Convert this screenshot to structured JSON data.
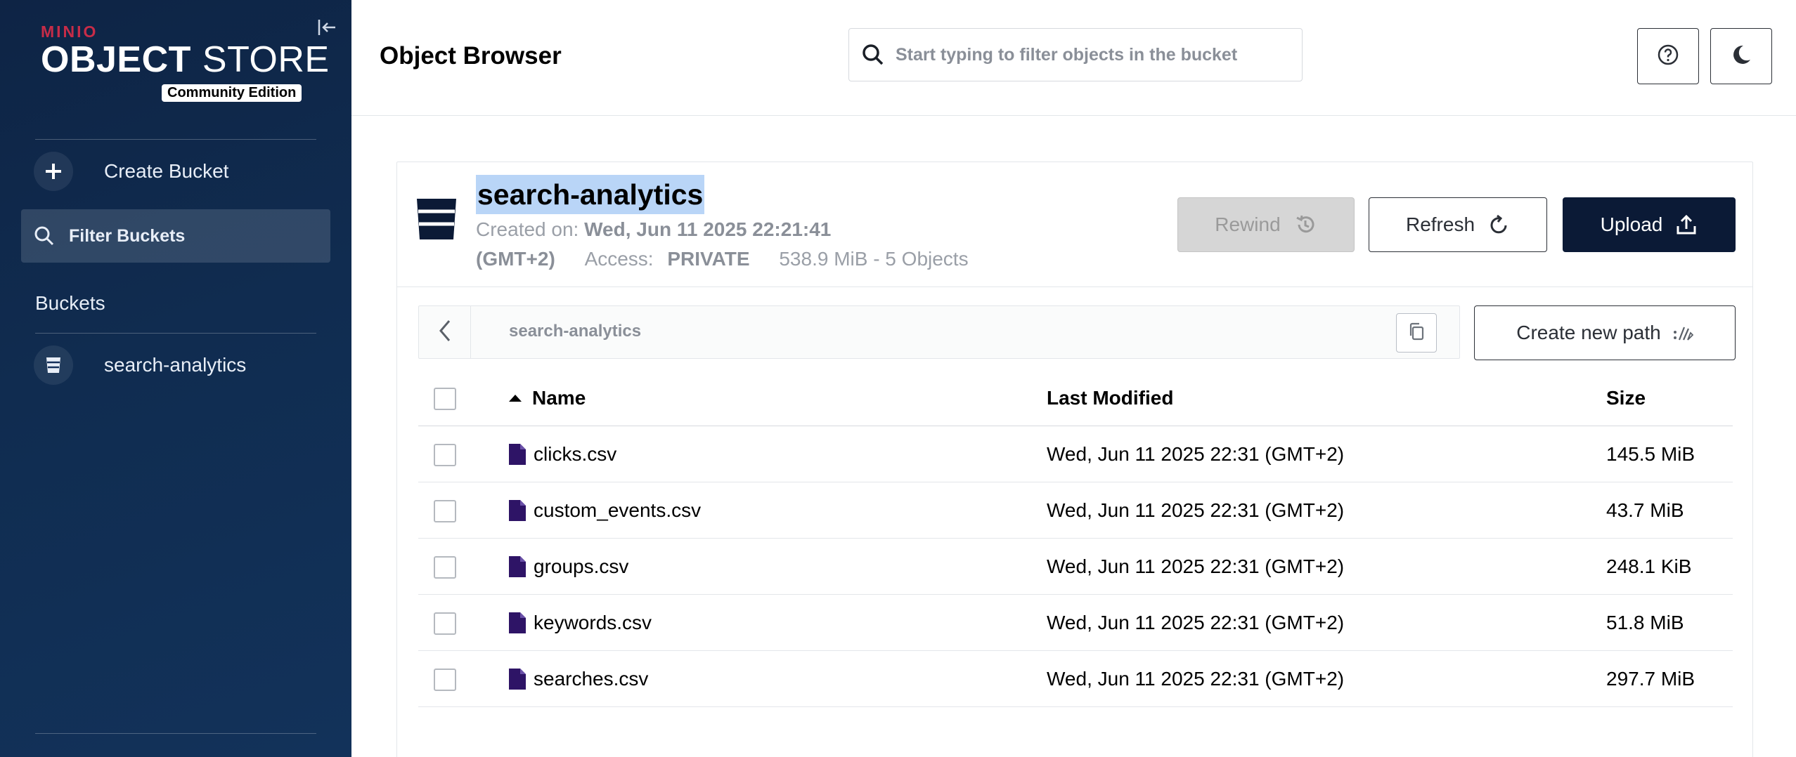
{
  "sidebar": {
    "logo": {
      "brand": "MINIO",
      "line1": "OBJECT",
      "line2": "STORE",
      "edition": "Community Edition"
    },
    "create_bucket": "Create Bucket",
    "filter_buckets": "Filter Buckets",
    "buckets_heading": "Buckets",
    "buckets": [
      {
        "name": "search-analytics"
      }
    ]
  },
  "header": {
    "title": "Object Browser",
    "search_placeholder": "Start typing to filter objects in the bucket"
  },
  "bucket": {
    "name": "search-analytics",
    "created_label": "Created on:",
    "created_value": "Wed, Jun 11 2025 22:21:41",
    "created_tz": "(GMT+2)",
    "access_label": "Access:",
    "access_value": "PRIVATE",
    "usage": "538.9 MiB - 5 Objects"
  },
  "actions": {
    "rewind": "Rewind",
    "refresh": "Refresh",
    "upload": "Upload",
    "create_path": "Create new path"
  },
  "path": {
    "current": "search-analytics"
  },
  "table": {
    "columns": {
      "name": "Name",
      "modified": "Last Modified",
      "size": "Size"
    },
    "rows": [
      {
        "name": "clicks.csv",
        "modified": "Wed, Jun 11 2025 22:31 (GMT+2)",
        "size": "145.5 MiB"
      },
      {
        "name": "custom_events.csv",
        "modified": "Wed, Jun 11 2025 22:31 (GMT+2)",
        "size": "43.7 MiB"
      },
      {
        "name": "groups.csv",
        "modified": "Wed, Jun 11 2025 22:31 (GMT+2)",
        "size": "248.1 KiB"
      },
      {
        "name": "keywords.csv",
        "modified": "Wed, Jun 11 2025 22:31 (GMT+2)",
        "size": "51.8 MiB"
      },
      {
        "name": "searches.csv",
        "modified": "Wed, Jun 11 2025 22:31 (GMT+2)",
        "size": "297.7 MiB"
      }
    ]
  },
  "colors": {
    "sidebar_bg": "#102c50",
    "brand_red": "#c72c48",
    "primary_dark": "#0b1a36",
    "file_icon": "#2e1466",
    "selection_highlight": "#b9d5f7"
  },
  "icons": [
    "collapse-sidebar-icon",
    "plus-icon",
    "search-icon",
    "bucket-icon",
    "help-icon",
    "moon-icon",
    "rewind-icon",
    "refresh-icon",
    "upload-icon",
    "chevron-left-icon",
    "copy-icon",
    "new-path-icon",
    "sort-asc-icon",
    "file-icon"
  ]
}
